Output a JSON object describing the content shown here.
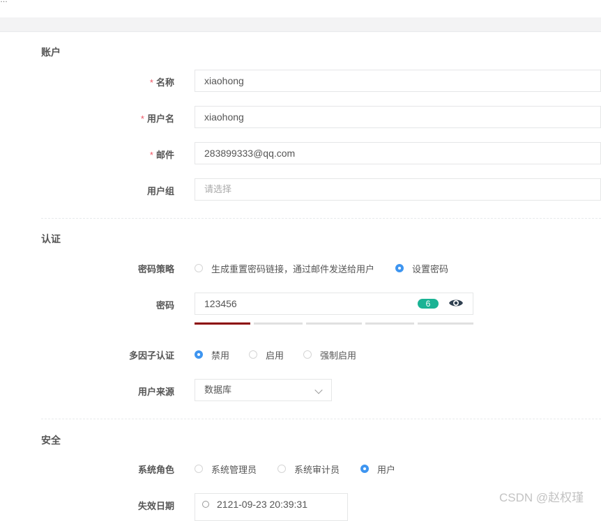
{
  "header": {
    "cut_text": "…"
  },
  "sections": {
    "account": "账户",
    "auth": "认证",
    "security": "安全"
  },
  "fields": {
    "name": {
      "label": "名称",
      "value": "xiaohong",
      "required": "*"
    },
    "username": {
      "label": "用户名",
      "value": "xiaohong",
      "required": "*"
    },
    "email": {
      "label": "邮件",
      "value": "283899333@qq.com",
      "required": "*"
    },
    "user_group": {
      "label": "用户组",
      "placeholder": "请选择"
    },
    "password_strategy": {
      "label": "密码策略",
      "options": [
        "生成重置密码链接，通过邮件发送给用户",
        "设置密码"
      ],
      "selected": "设置密码"
    },
    "password": {
      "label": "密码",
      "value": "123456",
      "length_badge": "6",
      "strength_segments_filled": 1,
      "strength_segments_total": 5
    },
    "mfa": {
      "label": "多因子认证",
      "options": [
        "禁用",
        "启用",
        "强制启用"
      ],
      "selected": "禁用"
    },
    "source": {
      "label": "用户来源",
      "value": "数据库"
    },
    "system_role": {
      "label": "系统角色",
      "options": [
        "系统管理员",
        "系统审计员",
        "用户"
      ],
      "selected": "用户"
    },
    "expire_date": {
      "label": "失效日期",
      "value": "2121-09-23 20:39:31"
    }
  },
  "watermark": "CSDN @赵权瑾",
  "colors": {
    "accent": "#3e95f0",
    "required": "#ed5565",
    "badge": "#1ab394",
    "strength": "#8b0000"
  }
}
